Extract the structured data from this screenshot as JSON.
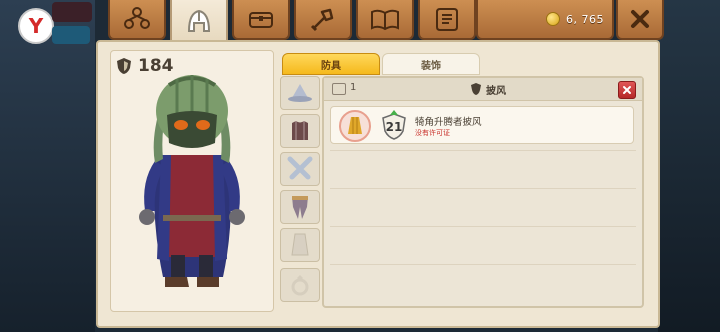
{
  "hud": {
    "logo_letter": "Y"
  },
  "tabs": [
    {
      "name": "party-icon"
    },
    {
      "name": "helmet-icon",
      "active": true
    },
    {
      "name": "chest-icon"
    },
    {
      "name": "crafting-icon"
    },
    {
      "name": "book-icon"
    },
    {
      "name": "scroll-icon"
    }
  ],
  "currency": {
    "icon": "coin-icon",
    "amount": "6, 765"
  },
  "character": {
    "armor_icon": "shield-icon",
    "armor_value": "184"
  },
  "slots": [
    "hat-slot",
    "chest-slot",
    "weapon-slot",
    "legs-slot",
    "cape-slot",
    "ring-slot"
  ],
  "subtabs": {
    "armor": "防具",
    "decor": "装饰"
  },
  "list": {
    "count": "1",
    "type_label": "披风",
    "items": [
      {
        "level": "21",
        "name": "犄角升腾者披风",
        "status": "没有许可证"
      }
    ]
  },
  "colors": {
    "wood": "#b97a42",
    "panel": "#efe6d3",
    "accent": "#f5b91c",
    "close_red": "#c83434"
  }
}
